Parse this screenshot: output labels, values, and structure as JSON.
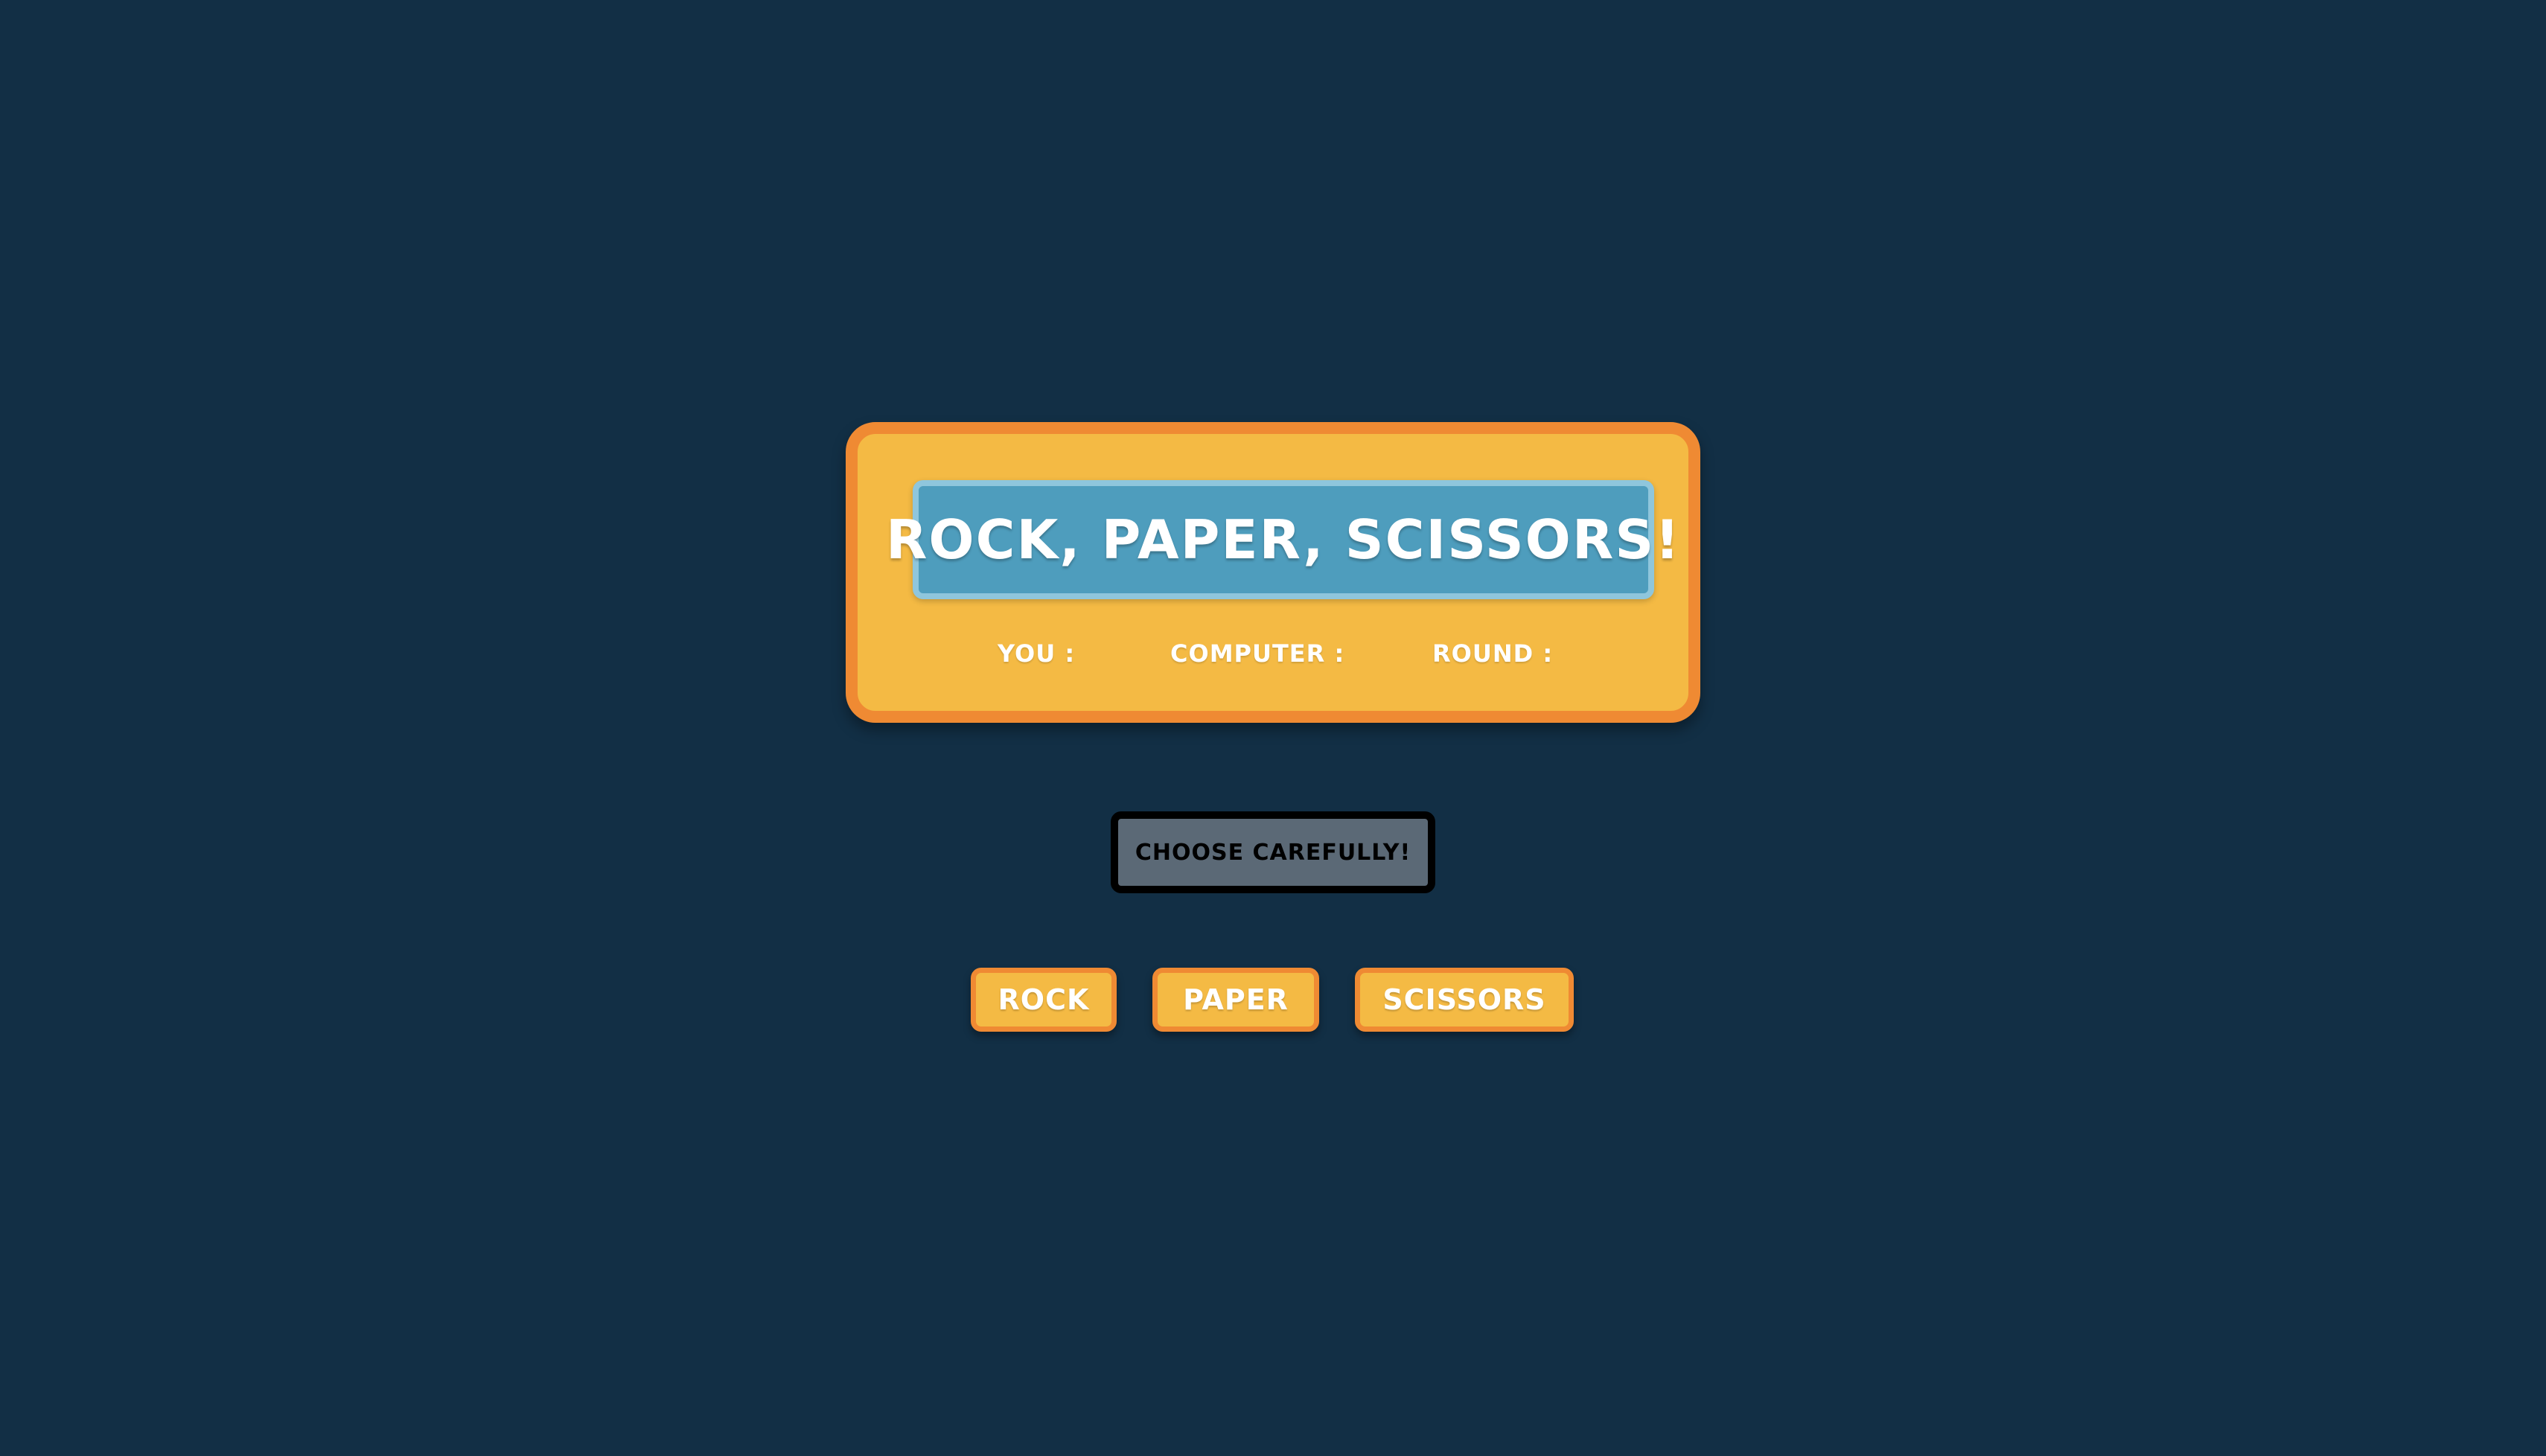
{
  "scoreboard": {
    "title": "ROCK, PAPER, SCISSORS!",
    "you_label": "YOU :",
    "computer_label": "COMPUTER :",
    "round_label": "ROUND :"
  },
  "message": {
    "text": "CHOOSE CAREFULLY!"
  },
  "choices": [
    {
      "label": "ROCK"
    },
    {
      "label": "PAPER"
    },
    {
      "label": "SCISSORS"
    }
  ],
  "colors": {
    "background": "#122f45",
    "panel": "#f4ba44",
    "panel_border": "#ef8a33",
    "title_panel": "#4e9dbd",
    "message_box": "#5b6976"
  }
}
